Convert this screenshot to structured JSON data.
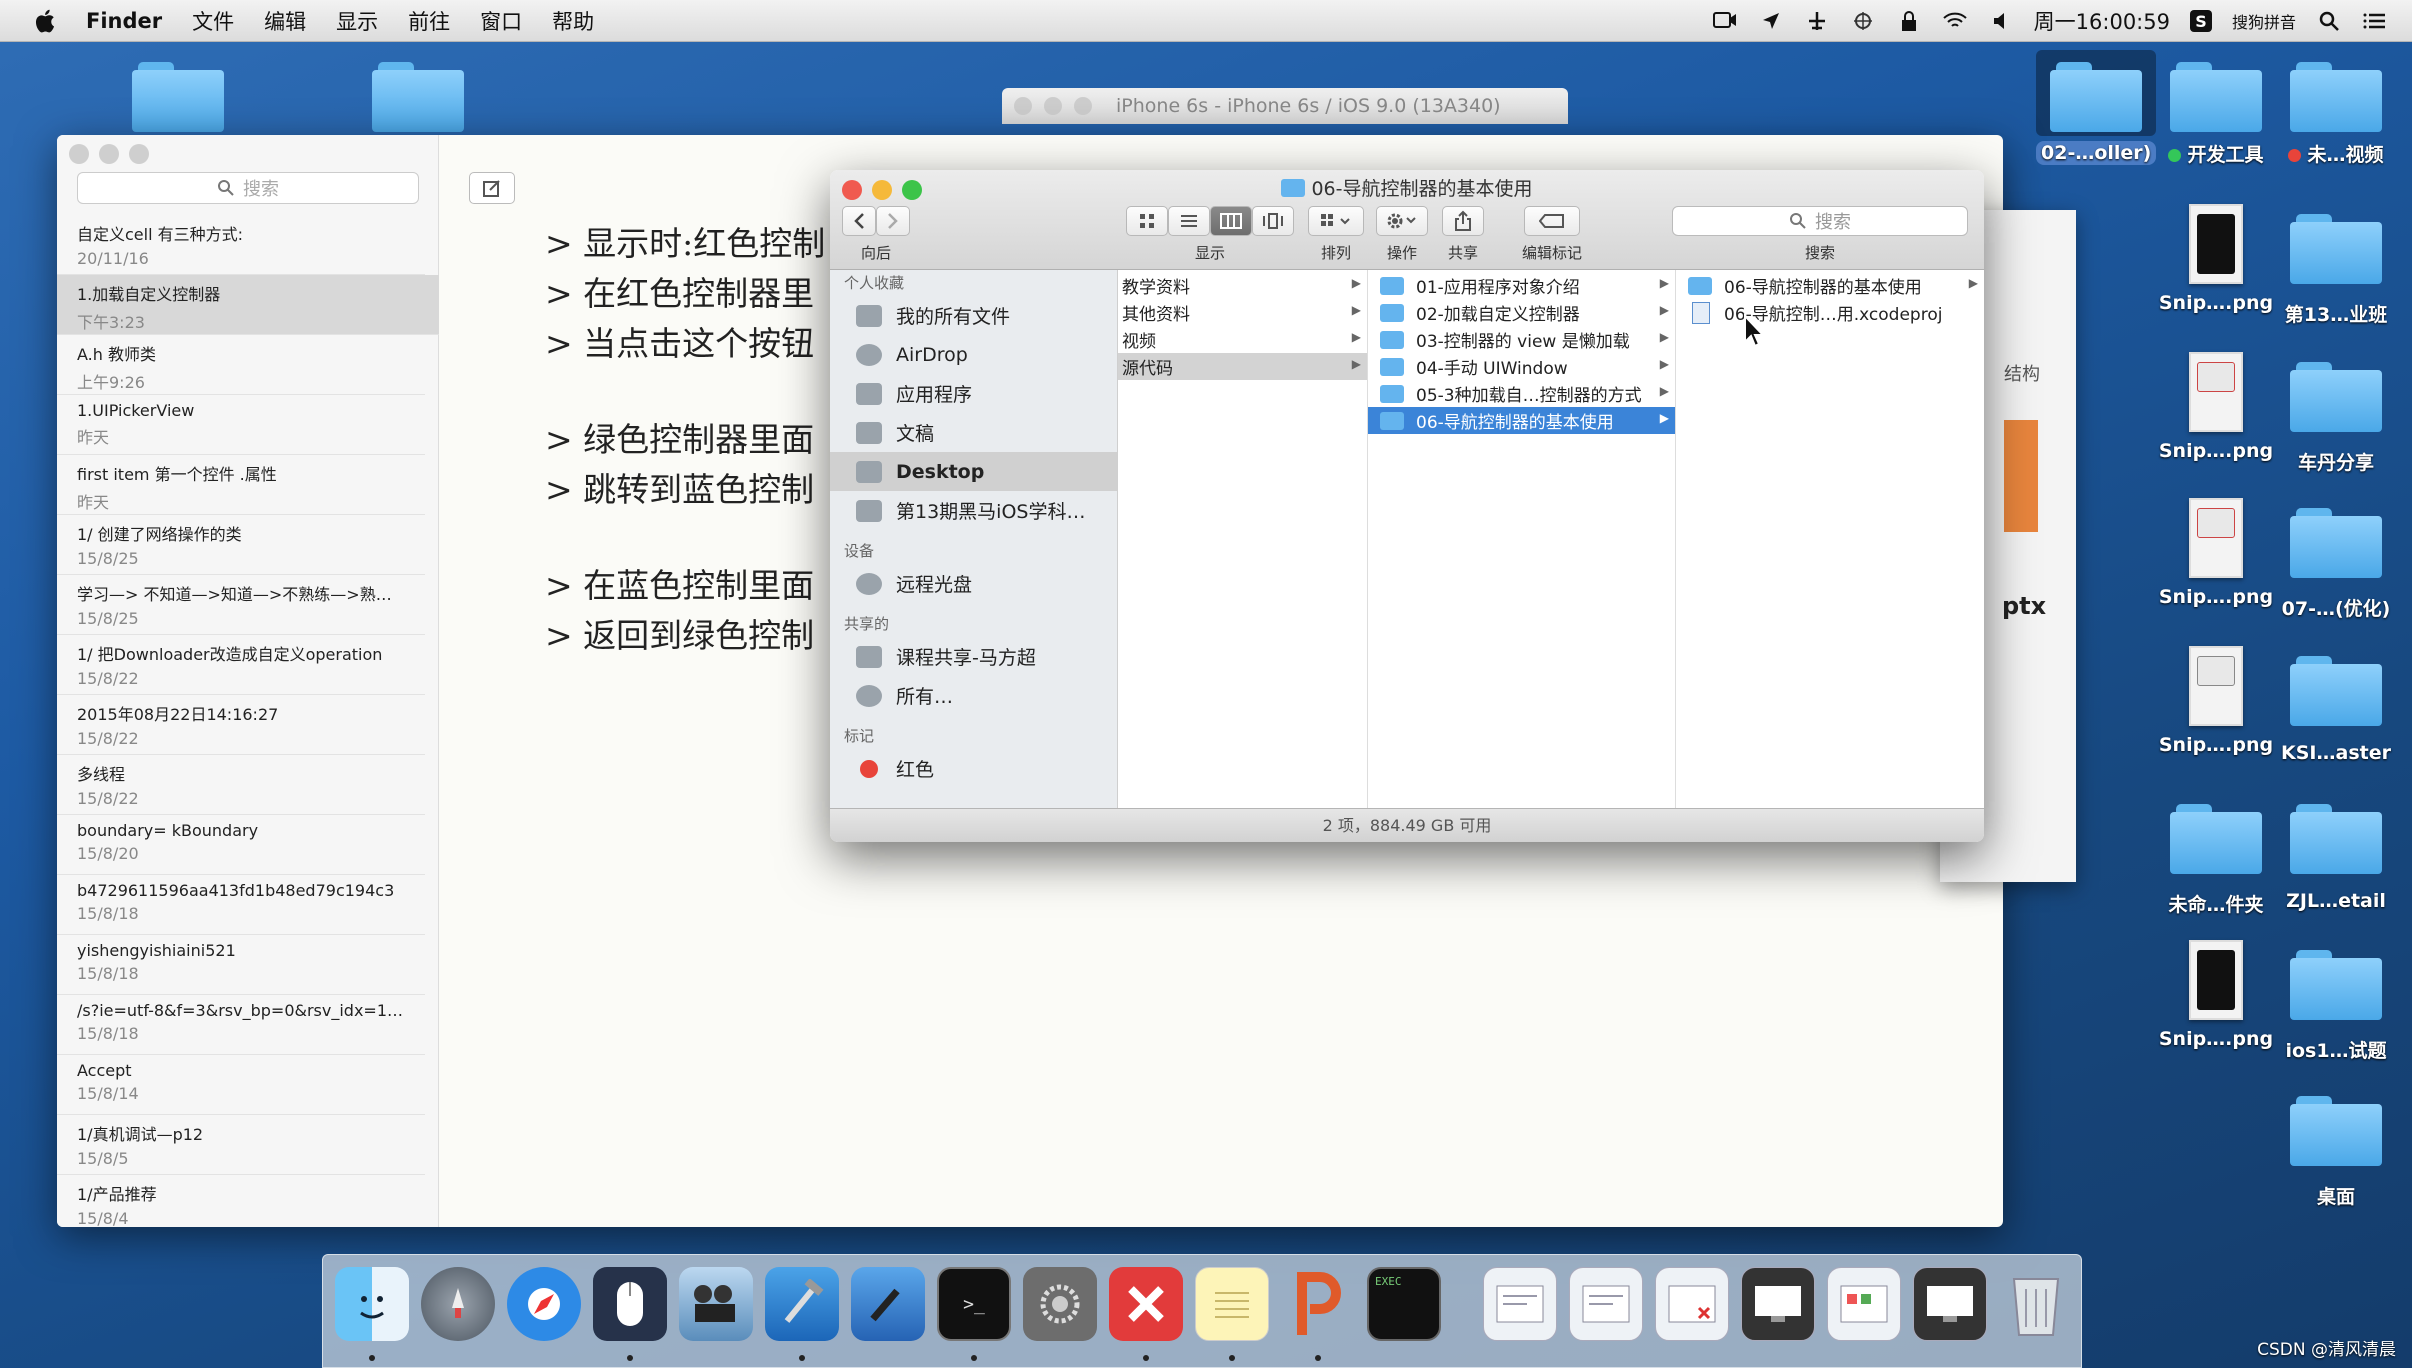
{
  "menubar": {
    "app": "Finder",
    "items": [
      "文件",
      "编辑",
      "显示",
      "前往",
      "窗口",
      "帮助"
    ],
    "clock": "周一16:00:59",
    "input_method": "搜狗拼音"
  },
  "simulator": {
    "title": "iPhone 6s - iPhone 6s / iOS 9.0 (13A340)"
  },
  "desktop_icons": {
    "top_left": [
      "folder",
      "folder"
    ],
    "col1": [
      {
        "label": "02-…oller)",
        "kind": "folder"
      },
      {
        "label": "Snip….png",
        "kind": "thumb-phone"
      },
      {
        "label": "Snip….png",
        "kind": "thumb-doc"
      },
      {
        "label": "Snip….png",
        "kind": "thumb-doc"
      },
      {
        "label": "Snip….png",
        "kind": "thumb-doc"
      },
      {
        "label": "未命…件夹",
        "kind": "folder"
      },
      {
        "label": "Snip….png",
        "kind": "thumb-phone"
      }
    ],
    "tag_items": [
      {
        "label": "开发工具",
        "color": "#34c759"
      },
      {
        "label": "未…视频",
        "color": "#e8443a"
      }
    ],
    "col2": [
      {
        "label": "第13…业班"
      },
      {
        "label": "车丹分享"
      },
      {
        "label": "07-…(优化)"
      },
      {
        "label": "KSI…aster"
      },
      {
        "label": "ZJL…etail"
      },
      {
        "label": "ios1…试题"
      },
      {
        "label": "桌面"
      }
    ]
  },
  "notes": {
    "search_placeholder": "搜索",
    "items": [
      {
        "title": "自定义cell 有三种方式:",
        "date": "20/11/16"
      },
      {
        "title": "1.加载自定义控制器",
        "date": "下午3:23",
        "selected": true
      },
      {
        "title": "A.h  教师类",
        "date": "上午9:26"
      },
      {
        "title": "1.UIPickerView",
        "date": "昨天"
      },
      {
        "title": "first item 第一个控件 .属性",
        "date": "昨天"
      },
      {
        "title": "1/ 创建了网络操作的类",
        "date": "15/8/25"
      },
      {
        "title": "学习—> 不知道—>知道—>不熟练—>熟…",
        "date": "15/8/25"
      },
      {
        "title": "1/ 把Downloader改造成自定义operation",
        "date": "15/8/22"
      },
      {
        "title": "2015年08月22日14:16:27",
        "date": "15/8/22"
      },
      {
        "title": "多线程",
        "date": "15/8/22"
      },
      {
        "title": "boundary= kBoundary",
        "date": "15/8/20"
      },
      {
        "title": "b4729611596aa413fd1b48ed79c194c3",
        "date": "15/8/18"
      },
      {
        "title": "yishengyishiaini521",
        "date": "15/8/18"
      },
      {
        "title": "/s?ie=utf-8&f=3&rsv_bp=0&rsv_idx=1…",
        "date": "15/8/18"
      },
      {
        "title": "Accept",
        "date": "15/8/14"
      },
      {
        "title": "1/真机调试—p12",
        "date": "15/8/5"
      },
      {
        "title": "1/产品推荐",
        "date": "15/8/4"
      }
    ],
    "body_lines": [
      "> 显示时:红色控制",
      "> 在红色控制器里",
      "> 当点击这个按钮",
      "",
      "> 绿色控制器里面",
      "> 跳转到蓝色控制",
      "",
      "> 在蓝色控制里面",
      "> 返回到绿色控制"
    ]
  },
  "behind_window": {
    "text1": "结构",
    "text2": "ptx"
  },
  "finder": {
    "title": "06-导航控制器的基本使用",
    "toolbar_labels": {
      "nav": "向后",
      "view": "显示",
      "arrange": "排列",
      "action": "操作",
      "share": "共享",
      "tags": "编辑标记",
      "search": "搜索"
    },
    "search_placeholder": "搜索",
    "sidebar": [
      {
        "type": "head",
        "label": "个人收藏"
      },
      {
        "type": "item",
        "label": "我的所有文件"
      },
      {
        "type": "item",
        "label": "AirDrop"
      },
      {
        "type": "item",
        "label": "应用程序"
      },
      {
        "type": "item",
        "label": "文稿"
      },
      {
        "type": "item",
        "label": "Desktop",
        "selected": true
      },
      {
        "type": "item",
        "label": "第13期黑马iOS学科…"
      },
      {
        "type": "head",
        "label": "设备"
      },
      {
        "type": "item",
        "label": "远程光盘"
      },
      {
        "type": "head",
        "label": "共享的"
      },
      {
        "type": "item",
        "label": "课程共享-马方超"
      },
      {
        "type": "item",
        "label": "所有…"
      },
      {
        "type": "head",
        "label": "标记"
      },
      {
        "type": "item",
        "label": "红色",
        "tag": "#e8443a"
      }
    ],
    "column1": [
      {
        "label": "教学资料"
      },
      {
        "label": "其他资料"
      },
      {
        "label": "视频"
      },
      {
        "label": "源代码",
        "state": "grey"
      }
    ],
    "column2": [
      {
        "label": "01-应用程序对象介绍"
      },
      {
        "label": "02-加载自定义控制器"
      },
      {
        "label": "03-控制器的 view 是懒加载"
      },
      {
        "label": "04-手动 UIWindow"
      },
      {
        "label": "05-3种加载自…控制器的方式"
      },
      {
        "label": "06-导航控制器的基本使用",
        "state": "blue"
      }
    ],
    "column3": [
      {
        "label": "06-导航控制器的基本使用",
        "kind": "folder"
      },
      {
        "label": "06-导航控制…用.xcodeproj",
        "kind": "xcodeproj"
      }
    ],
    "status": "2 项，884.49 GB 可用"
  },
  "dock": {
    "apps": [
      "finder",
      "launchpad",
      "safari",
      "mouse",
      "imovie",
      "xcode",
      "instruments",
      "terminal",
      "system-preferences",
      "xmind",
      "notes",
      "powerpoint",
      "console"
    ],
    "docs": [
      "doc-1",
      "doc-2",
      "doc-3",
      "doc-4",
      "doc-5",
      "doc-6",
      "trash"
    ]
  },
  "watermark": "CSDN @清风清晨",
  "colors": {
    "finder_selection": "#3b84d8",
    "folder": "#64b4ee",
    "desktop": "#1d5aa3"
  }
}
